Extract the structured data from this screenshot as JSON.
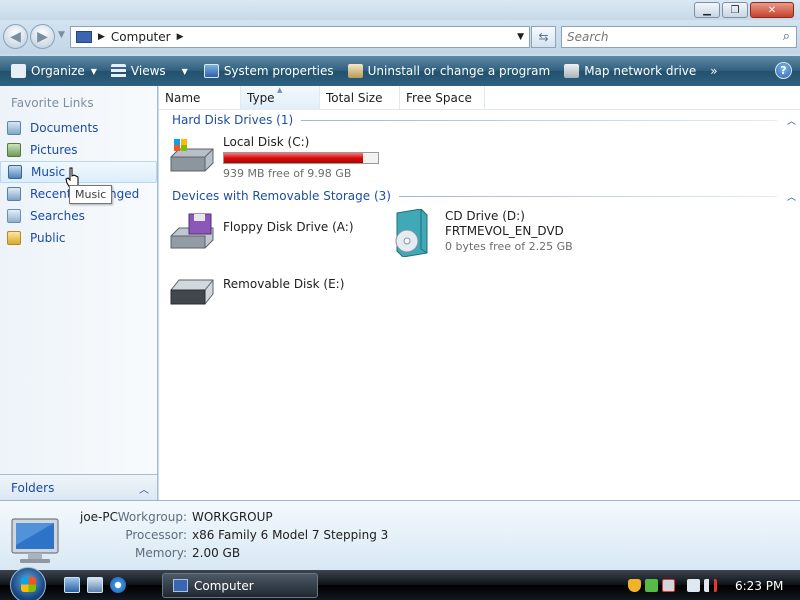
{
  "window": {
    "minimize_glyph": "▁",
    "maximize_glyph": "❐",
    "close_glyph": "✕"
  },
  "address": {
    "location": "Computer",
    "search_placeholder": "Search"
  },
  "toolbar": {
    "organize": "Organize",
    "views": "Views",
    "system_properties": "System properties",
    "uninstall": "Uninstall or change a program",
    "map_drive": "Map network drive",
    "more": "»",
    "help": "?"
  },
  "nav": {
    "favorite_title": "Favorite Links",
    "items": [
      {
        "label": "Documents",
        "icon": "documents-icon"
      },
      {
        "label": "Pictures",
        "icon": "pictures-icon"
      },
      {
        "label": "Music",
        "icon": "music-icon"
      },
      {
        "label": "Recently Changed",
        "icon": "recent-icon"
      },
      {
        "label": "Searches",
        "icon": "searches-icon"
      },
      {
        "label": "Public",
        "icon": "public-folder-icon"
      }
    ],
    "tooltip": "Music",
    "folders": "Folders"
  },
  "columns": [
    "Name",
    "Type",
    "Total Size",
    "Free Space"
  ],
  "groups": {
    "hard_disks": "Hard Disk Drives (1)",
    "removable": "Devices with Removable Storage (3)"
  },
  "drives": {
    "local": {
      "name": "Local Disk (C:)",
      "free": "939 MB free of 9.98 GB",
      "used_fraction": 0.905
    },
    "floppy": {
      "name": "Floppy Disk Drive (A:)"
    },
    "cd": {
      "name": "CD Drive (D:)",
      "label": "FRTMEVOL_EN_DVD",
      "free": "0 bytes free of 2.25 GB"
    },
    "removable": {
      "name": "Removable Disk (E:)"
    }
  },
  "details": {
    "computer_name": "joe-PC",
    "workgroup_label": "Workgroup:",
    "workgroup": "WORKGROUP",
    "processor_label": "Processor:",
    "processor": "x86 Family 6 Model 7 Stepping 3",
    "memory_label": "Memory:",
    "memory": "2.00 GB"
  },
  "taskbar": {
    "task_label": "Computer",
    "clock": "6:23 PM"
  },
  "colors": {
    "toolbar": "#2f5e7d",
    "link": "#1a4ba5",
    "bar_fill": "#d50c0c"
  }
}
